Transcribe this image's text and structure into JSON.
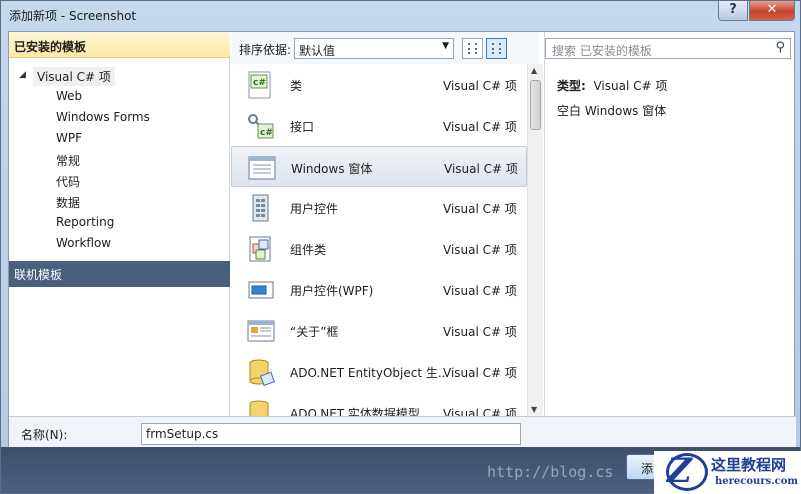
{
  "window": {
    "title": "添加新项 - Screenshot",
    "help": "?",
    "close": "✕"
  },
  "left": {
    "installed_header": "已安装的模板",
    "tree_root": "Visual C# 项",
    "tree_items": [
      "Web",
      "Windows Forms",
      "WPF",
      "常规",
      "代码",
      "数据",
      "Reporting",
      "Workflow"
    ],
    "online": "联机模板"
  },
  "toolbar": {
    "sort_label": "排序依据:",
    "sort_value": "默认值"
  },
  "templates": [
    {
      "name": "类",
      "type": "Visual C# 项",
      "icon": "class-icon"
    },
    {
      "name": "接口",
      "type": "Visual C# 项",
      "icon": "interface-icon"
    },
    {
      "name": "Windows 窗体",
      "type": "Visual C# 项",
      "icon": "windows-form-icon",
      "selected": true
    },
    {
      "name": "用户控件",
      "type": "Visual C# 项",
      "icon": "user-control-icon"
    },
    {
      "name": "组件类",
      "type": "Visual C# 项",
      "icon": "component-class-icon"
    },
    {
      "name": "用户控件(WPF)",
      "type": "Visual C# 项",
      "icon": "wpf-user-control-icon"
    },
    {
      "name": "“关于”框",
      "type": "Visual C# 项",
      "icon": "about-box-icon"
    },
    {
      "name": "ADO.NET EntityObject 生...",
      "type": "Visual C# 项",
      "icon": "entity-object-icon"
    },
    {
      "name": "ADO.NET 实体数据模型",
      "type": "Visual C# 项",
      "icon": "entity-model-icon"
    }
  ],
  "search": {
    "placeholder": "搜索 已安装的模板"
  },
  "details": {
    "type_label": "类型:",
    "type_value": "Visual C# 项",
    "description": "空白 Windows 窗体"
  },
  "name_field": {
    "label": "名称(N):",
    "value": "frmSetup.cs"
  },
  "add_button": "添",
  "watermark": {
    "url": "http://blog.cs",
    "logo_letter": "Z",
    "logo_title": "这里教程网",
    "logo_site": "herecours.com"
  }
}
